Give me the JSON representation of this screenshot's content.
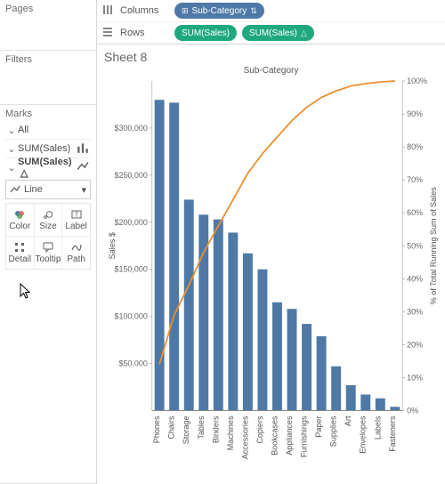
{
  "panels": {
    "pages": "Pages",
    "filters": "Filters",
    "marks": "Marks"
  },
  "marks_rows": {
    "all": "All",
    "sum1": "SUM(Sales)",
    "sum2": "SUM(Sales)"
  },
  "dropdown": {
    "value": "Line"
  },
  "cards": {
    "color": "Color",
    "size": "Size",
    "label": "Label",
    "detail": "Detail",
    "tooltip": "Tooltip",
    "path": "Path"
  },
  "shelves": {
    "columns": "Columns",
    "rows": "Rows",
    "pill_subcat": "Sub-Category",
    "pill_sum": "SUM(Sales)"
  },
  "sheet_title": "Sheet 8",
  "chart_data": {
    "type": "bar+line-dual-axis",
    "title": "Sub-Category",
    "y_left_label": "Sales $",
    "y_right_label": "% of Total Running Sum of Sales",
    "y_left_ticks": [
      "$50,000",
      "$100,000",
      "$150,000",
      "$200,000",
      "$250,000",
      "$300,000"
    ],
    "y_left_max": 350000,
    "y_right_ticks": [
      "0%",
      "10%",
      "20%",
      "30%",
      "40%",
      "50%",
      "60%",
      "70%",
      "80%",
      "90%",
      "100%"
    ],
    "y_right_max": 100,
    "categories": [
      "Phones",
      "Chairs",
      "Storage",
      "Tables",
      "Binders",
      "Machines",
      "Accessories",
      "Copiers",
      "Bookcases",
      "Appliances",
      "Furnishings",
      "Paper",
      "Supplies",
      "Art",
      "Envelopes",
      "Labels",
      "Fasteners"
    ],
    "bars": [
      330000,
      327000,
      224000,
      208000,
      203000,
      189000,
      167000,
      150000,
      115000,
      108000,
      92000,
      79000,
      47000,
      27000,
      17000,
      13000,
      4000
    ],
    "line_pct": [
      14,
      29,
      38,
      48,
      56,
      64,
      72,
      78,
      83,
      88,
      92,
      95,
      97,
      98.5,
      99.2,
      99.7,
      100
    ]
  }
}
